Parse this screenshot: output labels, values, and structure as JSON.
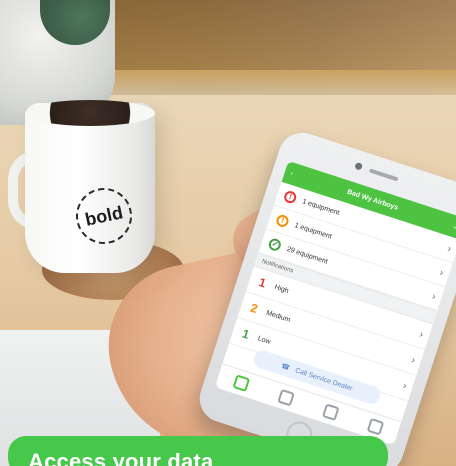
{
  "app": {
    "header": {
      "title": "Bad Wy Airboys",
      "back_icon": "chevron-left-icon",
      "menu_icon": "chevron-down-icon"
    },
    "equipment_status": [
      {
        "label": "1 equipment",
        "icon": "exclamation-icon",
        "color": "#e53935"
      },
      {
        "label": "1 equipment",
        "icon": "exclamation-icon",
        "color": "#fb8c00"
      },
      {
        "label": "29 equipment",
        "icon": "check-icon",
        "color": "#43a047"
      }
    ],
    "notifications_title": "Notifications",
    "notifications": [
      {
        "count": "1",
        "label": "High",
        "color": "#e53935"
      },
      {
        "count": "2",
        "label": "Medium",
        "color": "#fb8c00"
      },
      {
        "count": "1",
        "label": "Low",
        "color": "#43a047"
      }
    ],
    "call_button_label": "Call Service Dealer",
    "bottom_nav": [
      {
        "name": "home-icon",
        "active": true
      },
      {
        "name": "history-icon",
        "active": false
      },
      {
        "name": "calendar-icon",
        "active": false
      },
      {
        "name": "settings-icon",
        "active": false
      }
    ]
  },
  "scene": {
    "mug_text": "bold",
    "cta_text": "Access your data"
  },
  "colors": {
    "accent_green": "#4dc341",
    "cta_green": "#46c84b"
  }
}
